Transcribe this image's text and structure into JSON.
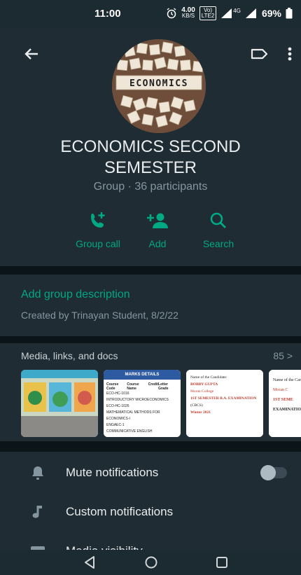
{
  "status_bar": {
    "time": "11:00",
    "speed_value": "4.00",
    "speed_unit": "KB/S",
    "volte_top": "Vo)",
    "volte_bottom": "LTE2",
    "network": "4G",
    "battery": "69%"
  },
  "group": {
    "name": "ECONOMICS SECOND SEMESTER",
    "meta": "Group · 36 participants",
    "avatar_text": "ECONOMICS"
  },
  "actions": [
    {
      "label": "Group call",
      "icon": "add-call-icon"
    },
    {
      "label": "Add",
      "icon": "add-person-icon"
    },
    {
      "label": "Search",
      "icon": "search-icon"
    }
  ],
  "description": {
    "add_label": "Add group description",
    "created": "Created by Trinayan Student, 8/2/22"
  },
  "media": {
    "title": "Media, links, and docs",
    "count": "85 >",
    "doc2_header": "MARKS DETAILS",
    "doc2_cols": [
      "Course Code",
      "Course Name",
      "Credit",
      "Letter Grade"
    ],
    "doc2_rows": [
      "ECO-HC-1016",
      "INTRODUCTORY MICROECONOMICS",
      "ECO-HC-1026",
      "MATHEMATICAL METHODS FOR ECONOMICS-I",
      "ENGAEC-1",
      "COMMUNICATIVE ENGLISH"
    ],
    "doc3_lines": [
      "Name of the Candidate:",
      "BOBBY GUPTA",
      "Moran College",
      "1ST SEMESTER B.A. EXAMINATION",
      "(CBCS)",
      "Winter 2021"
    ],
    "doc4_lines": [
      "Name of the Candidate:",
      "Moran C",
      "1ST SEME",
      "EXAMINATION"
    ]
  },
  "settings": [
    {
      "label": "Mute notifications",
      "icon": "bell-icon",
      "toggle": false
    },
    {
      "label": "Custom notifications",
      "icon": "music-note-icon"
    },
    {
      "label": "Media visibility",
      "icon": "image-icon"
    }
  ],
  "colors": {
    "accent": "#00a884",
    "background": "#0b1419",
    "surface": "#1f2c34"
  }
}
